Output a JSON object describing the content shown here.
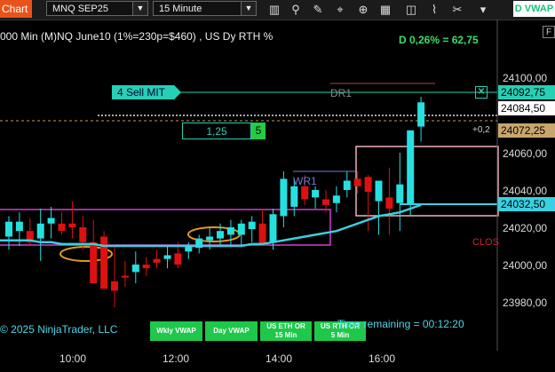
{
  "toolbar": {
    "chart_tab": "Chart",
    "instrument": "MNQ SEP25",
    "interval": "15 Minute",
    "vwap_button": "D VWAP",
    "icons": [
      "bars-icon",
      "magnify-icon",
      "pencil-icon",
      "crosshair-icon",
      "zoom-icon",
      "grid-icon",
      "strategy-icon",
      "indicator-icon",
      "tools-icon",
      "dropdown-icon"
    ]
  },
  "chart": {
    "title": "000 Min (M)NQ June10 (1%=230p=$460) , US Dy RTH %",
    "delta_text": "D 0,26% = 62,75",
    "f_button": "F",
    "y_labels": [
      "24100,00",
      "24084,50",
      "24060,00",
      "24040,00",
      "24020,00",
      "24000,00",
      "23980,00"
    ],
    "x_labels": [
      "10:00",
      "12:00",
      "14:00",
      "16:00"
    ],
    "price_tags": {
      "sell_price": "24092,75",
      "last_price": "24084,50",
      "orange_price": "24072,25",
      "cyan_price": "24032,50",
      "offset": "+0,2"
    },
    "order": {
      "label": "4  Sell MIT",
      "price_box": "1,25",
      "qty": "5"
    },
    "annotations": {
      "dr1": "DR1",
      "wr1": "WR1",
      "clo": "CLOS"
    },
    "copyright": "© 2025 NinjaTrader, LLC",
    "remaining": "Time remaining = 00:12:20",
    "buttons": [
      {
        "line1": "Wkly VWAP",
        "line2": ""
      },
      {
        "line1": "Day VWAP",
        "line2": ""
      },
      {
        "line1": "US ETH OR",
        "line2": "15 Min"
      },
      {
        "line1": "US RTH OR",
        "line2": "5 Min"
      }
    ],
    "colors": {
      "up": "#26e0e0",
      "down": "#dd1111",
      "vwap": "#3ad0e0",
      "magenta": "#d040d0",
      "pink": "#f0b0c0",
      "order": "#26d0b5"
    }
  },
  "chart_data": {
    "type": "candlestick",
    "x_ticks": [
      "10:00",
      "12:00",
      "14:00",
      "16:00"
    ],
    "ylim": [
      23970,
      24110
    ],
    "candles": [
      {
        "o": 24015,
        "h": 24026,
        "l": 24008,
        "c": 24023
      },
      {
        "o": 24018,
        "h": 24028,
        "l": 24010,
        "c": 24023
      },
      {
        "o": 24018,
        "h": 24025,
        "l": 24010,
        "c": 24012
      },
      {
        "o": 24014,
        "h": 24030,
        "l": 24002,
        "c": 24022
      },
      {
        "o": 24022,
        "h": 24031,
        "l": 24014,
        "c": 24025
      },
      {
        "o": 24022,
        "h": 24028,
        "l": 24016,
        "c": 24018
      },
      {
        "o": 24022,
        "h": 24034,
        "l": 24014,
        "c": 24020
      },
      {
        "o": 24020,
        "h": 24026,
        "l": 24008,
        "c": 24012
      },
      {
        "o": 24012,
        "h": 24024,
        "l": 23993,
        "c": 23990
      },
      {
        "o": 24015,
        "h": 24018,
        "l": 23988,
        "c": 23987
      },
      {
        "o": 23991,
        "h": 24010,
        "l": 23977,
        "c": 23986
      },
      {
        "o": 23994,
        "h": 24002,
        "l": 23988,
        "c": 23993
      },
      {
        "o": 23996,
        "h": 24007,
        "l": 23990,
        "c": 24000
      },
      {
        "o": 24000,
        "h": 24004,
        "l": 23994,
        "c": 23998
      },
      {
        "o": 24003,
        "h": 24008,
        "l": 23998,
        "c": 24001
      },
      {
        "o": 24003,
        "h": 24010,
        "l": 23998,
        "c": 24005
      },
      {
        "o": 24006,
        "h": 24012,
        "l": 23998,
        "c": 24000
      },
      {
        "o": 24007,
        "h": 24012,
        "l": 24003,
        "c": 24010
      },
      {
        "o": 24009,
        "h": 24016,
        "l": 24006,
        "c": 24014
      },
      {
        "o": 24013,
        "h": 24020,
        "l": 24008,
        "c": 24015
      },
      {
        "o": 24014,
        "h": 24022,
        "l": 24010,
        "c": 24018
      },
      {
        "o": 24016,
        "h": 24024,
        "l": 24010,
        "c": 24020
      },
      {
        "o": 24016,
        "h": 24024,
        "l": 24010,
        "c": 24022
      },
      {
        "o": 24019,
        "h": 24026,
        "l": 24012,
        "c": 24023
      },
      {
        "o": 24022,
        "h": 24030,
        "l": 24014,
        "c": 24010
      },
      {
        "o": 24012,
        "h": 24030,
        "l": 24008,
        "c": 24027
      },
      {
        "o": 24026,
        "h": 24050,
        "l": 24020,
        "c": 24046
      },
      {
        "o": 24031,
        "h": 24046,
        "l": 24026,
        "c": 24042
      },
      {
        "o": 24042,
        "h": 24048,
        "l": 24032,
        "c": 24035
      },
      {
        "o": 24036,
        "h": 24042,
        "l": 24030,
        "c": 24040
      },
      {
        "o": 24035,
        "h": 24040,
        "l": 24028,
        "c": 24032
      },
      {
        "o": 24033,
        "h": 24042,
        "l": 24028,
        "c": 24037
      },
      {
        "o": 24040,
        "h": 24050,
        "l": 24036,
        "c": 24045
      },
      {
        "o": 24046,
        "h": 24050,
        "l": 24038,
        "c": 24042
      },
      {
        "o": 24047,
        "h": 24048,
        "l": 24018,
        "c": 24039
      },
      {
        "o": 24034,
        "h": 24045,
        "l": 24016,
        "c": 24045
      },
      {
        "o": 24036,
        "h": 24052,
        "l": 24016,
        "c": 24030
      },
      {
        "o": 24033,
        "h": 24060,
        "l": 24018,
        "c": 24043
      },
      {
        "o": 24032,
        "h": 24070,
        "l": 24026,
        "c": 24072
      },
      {
        "o": 24074,
        "h": 24090,
        "l": 24066,
        "c": 24087
      }
    ],
    "vwap": [
      24013,
      24013,
      24013,
      24012,
      24012,
      24011,
      24011,
      24011,
      24011,
      24010,
      24010,
      24010,
      24010,
      24010,
      24010,
      24010,
      24010,
      24010,
      24010,
      24010,
      24010,
      24010,
      24010,
      24011,
      24011,
      24012,
      24013,
      24014,
      24015,
      24016,
      24017,
      24018,
      24020,
      24022,
      24024,
      24026,
      24027,
      24028,
      24030,
      24032
    ]
  }
}
